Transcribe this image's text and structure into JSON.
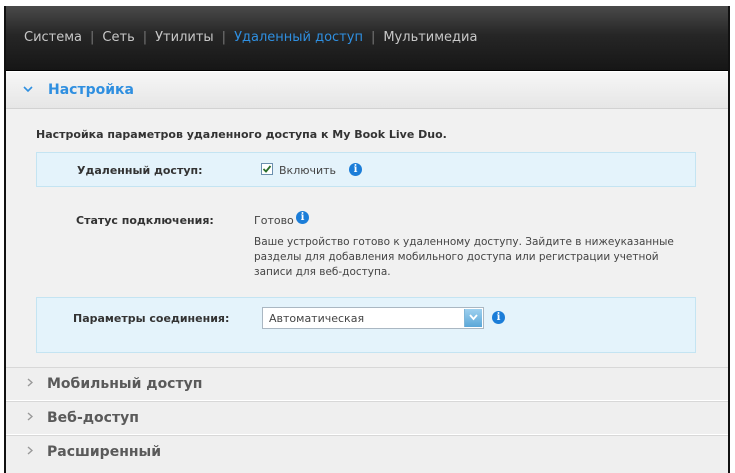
{
  "topnav": {
    "items": [
      {
        "label": "Система"
      },
      {
        "label": "Сеть"
      },
      {
        "label": "Утилиты"
      },
      {
        "label": "Удаленный доступ"
      },
      {
        "label": "Мультимедиа"
      }
    ],
    "separator": "|"
  },
  "section": {
    "title": "Настройка",
    "intro": "Настройка параметров удаленного доступа к My Book Live Duo.",
    "remote_access": {
      "label": "Удаленный доступ:",
      "checkbox_label": "Включить",
      "checked": true
    },
    "connection_status": {
      "label": "Статус подключения:",
      "value": "Готово",
      "description": "Ваше устройство готово к удаленному доступу. Зайдите в нижеуказанные разделы для добавления мобильного доступа или регистрации учетной записи для веб-доступа."
    },
    "connection_params": {
      "label": "Параметры соединения:",
      "selected": "Автоматическая"
    }
  },
  "collapsed_sections": [
    {
      "title": "Мобильный доступ"
    },
    {
      "title": "Веб-доступ"
    },
    {
      "title": "Расширенный"
    }
  ],
  "icons": {
    "info": "i",
    "chevron_expanded": "⌄",
    "chevron_collapsed": "›"
  },
  "colors": {
    "accent": "#2f8fe0",
    "highlight_row": "#e4f3fb",
    "nav_bg": "#1e1e1e"
  }
}
